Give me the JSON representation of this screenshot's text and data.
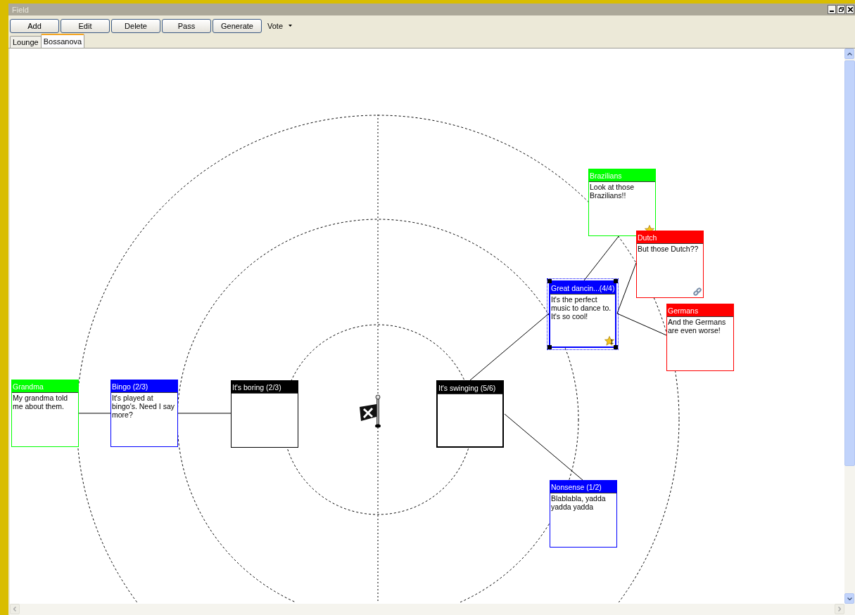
{
  "window": {
    "title": "Field"
  },
  "toolbar": {
    "buttons": [
      "Add",
      "Edit",
      "Delete",
      "Pass",
      "Generate"
    ],
    "dropdown": {
      "label": "Vote"
    }
  },
  "tabs": [
    {
      "label": "Lounge",
      "selected": false
    },
    {
      "label": "Bossanova",
      "selected": true
    }
  ],
  "map": {
    "nodes": [
      {
        "title": "It's boring (2/3)",
        "color": "#000000",
        "selected": false,
        "bold": false,
        "children": [
          {
            "title": "Bingo (2/3)",
            "body": "It's played at bingo's. Need I say more?",
            "color": "#0000ff",
            "selected": false,
            "bold": false,
            "children": [
              {
                "title": "Grandma",
                "body": "My grandma told me about them.",
                "color": "#00ff00",
                "selected": false,
                "bold": false
              }
            ]
          }
        ]
      },
      {
        "title": "It's swinging (5/6)",
        "color": "#000000",
        "selected": false,
        "bold": true,
        "children": [
          {
            "title": "Great dancin...(4/4)",
            "body": "It's the perfect music to dance to. It's so cool!",
            "color": "#0000ff",
            "selected": true,
            "bold": true,
            "badge": {
              "kind": "star",
              "count": "1"
            },
            "children": [
              {
                "title": "Brazilians",
                "body": "Look at those Brazilians!!",
                "color": "#00ff00",
                "selected": false,
                "bold": false,
                "badge": {
                  "kind": "star"
                }
              },
              {
                "title": "Dutch",
                "body": "But those Dutch??",
                "color": "#ff0000",
                "selected": false,
                "bold": false,
                "badge": {
                  "kind": "link"
                }
              },
              {
                "title": "Germans",
                "body": "And the Germans are even worse!",
                "color": "#ff0000",
                "selected": false,
                "bold": false
              }
            ]
          },
          {
            "title": "Nonsense (1/2)",
            "body": "Blablabla, yadda yadda yadda",
            "color": "#0000ff",
            "selected": false,
            "bold": false
          }
        ]
      }
    ]
  }
}
